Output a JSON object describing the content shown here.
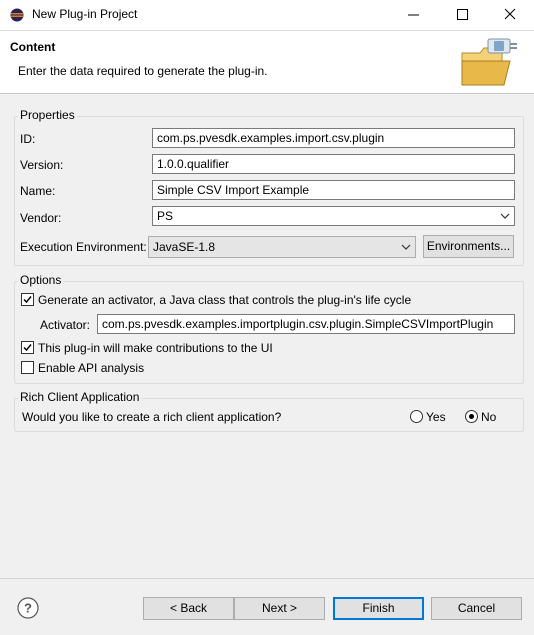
{
  "window": {
    "title": "New Plug-in Project",
    "icon": "eclipse-icon",
    "controls": [
      "minimize-icon",
      "maximize-icon",
      "close-icon"
    ]
  },
  "header": {
    "title": "Content",
    "description": "Enter the data required to generate the plug-in.",
    "image": "plugin-folder-icon"
  },
  "properties": {
    "label": "Properties",
    "id_label": "ID:",
    "id_value": "com.ps.pvesdk.examples.import.csv.plugin",
    "version_label": "Version:",
    "version_value": "1.0.0.qualifier",
    "name_label": "Name:",
    "name_value": "Simple CSV Import Example",
    "vendor_label": "Vendor:",
    "vendor_value": "PS",
    "env_label": "Execution Environment:",
    "env_value": "JavaSE-1.8",
    "env_button": "Environments..."
  },
  "options": {
    "label": "Options",
    "generate_activator_label": "Generate an activator, a Java class that controls the plug-in's life cycle",
    "generate_activator_checked": true,
    "activator_label": "Activator:",
    "activator_value": "com.ps.pvesdk.examples.importplugin.csv.plugin.SimpleCSVImportPlugin",
    "contributions_label": "This plug-in will make contributions to the UI",
    "contributions_checked": true,
    "api_analysis_label": "Enable API analysis",
    "api_analysis_checked": false
  },
  "rca": {
    "label": "Rich Client Application",
    "question": "Would you like to create a rich client application?",
    "yes_label": "Yes",
    "no_label": "No",
    "selected": "No"
  },
  "footer": {
    "help_icon": "help-icon",
    "back_label": "< Back",
    "next_label": "Next >",
    "finish_label": "Finish",
    "cancel_label": "Cancel"
  },
  "colors": {
    "accent": "#0078d7",
    "background": "#f0f0f0"
  }
}
